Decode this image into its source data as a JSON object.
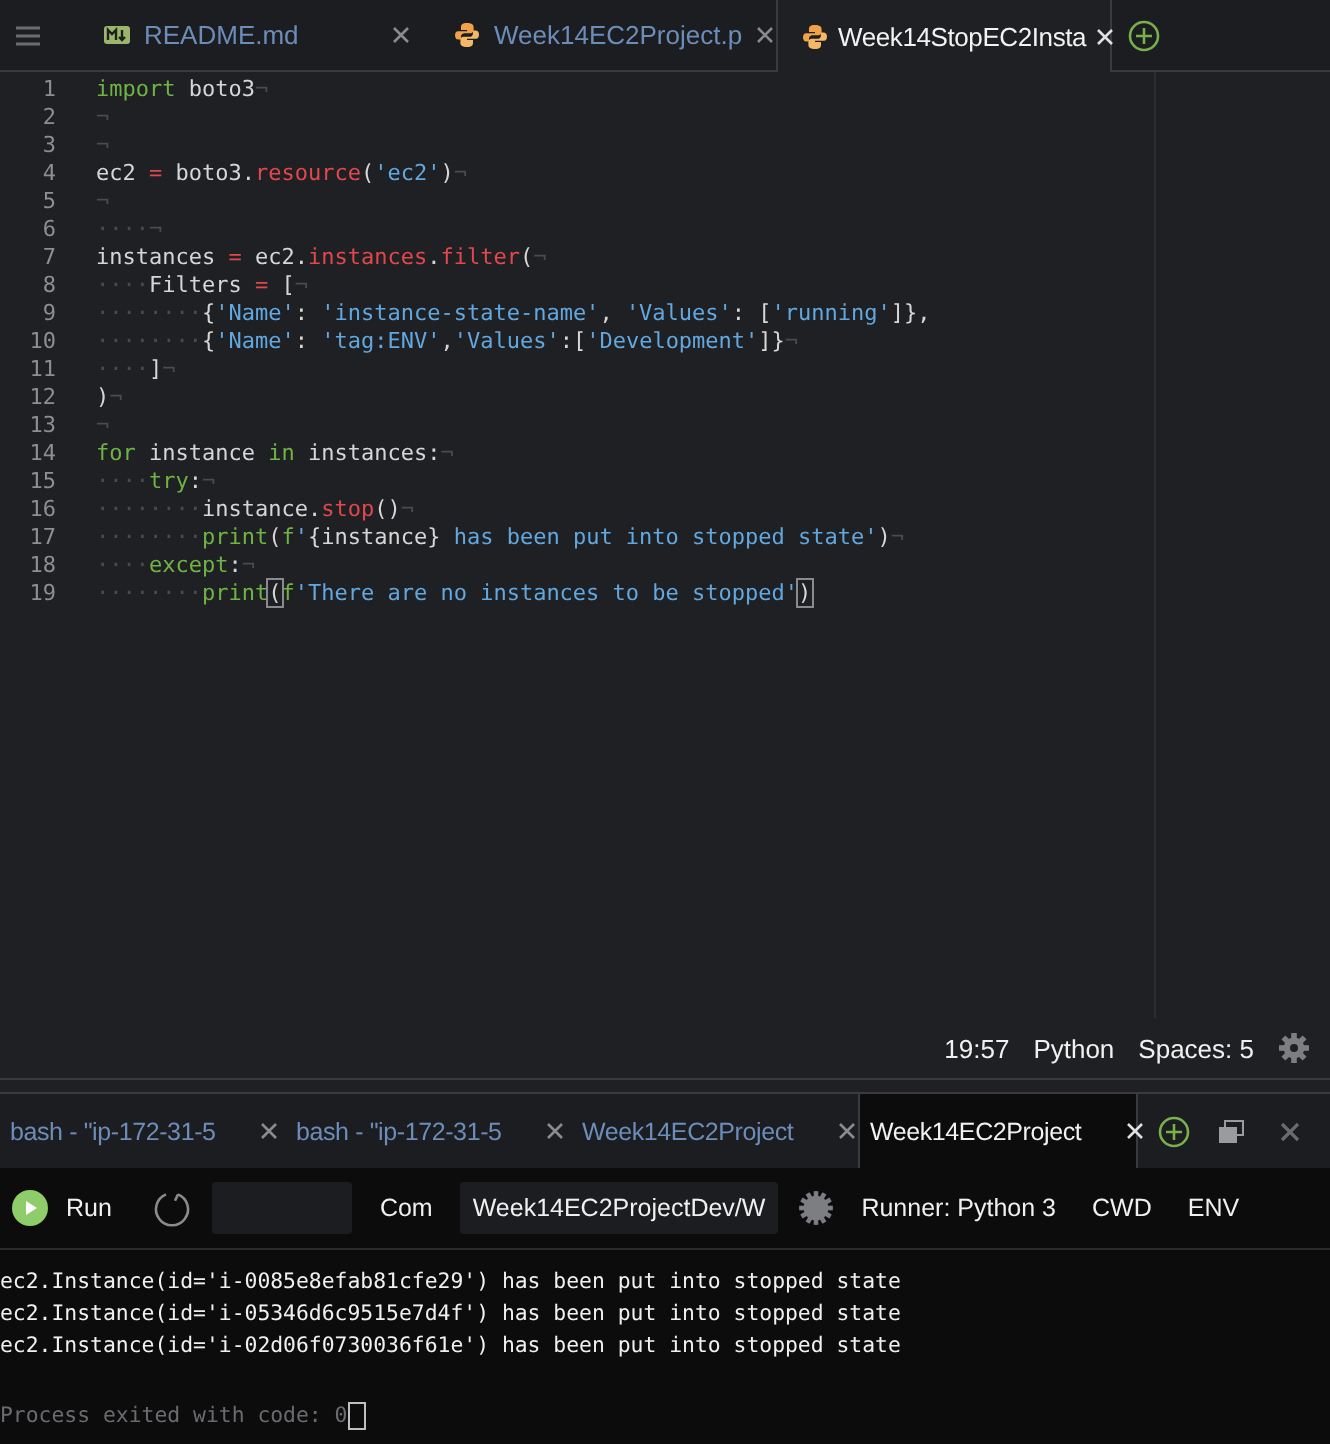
{
  "editor_tabs": [
    {
      "label": "README.md",
      "kind": "markdown",
      "selected": false
    },
    {
      "label": "Week14EC2Project.p",
      "kind": "python",
      "selected": false
    },
    {
      "label": "Week14StopEC2Insta",
      "kind": "python",
      "selected": true
    }
  ],
  "code_lines": [
    {
      "number": "1",
      "tokens": [
        {
          "text": "import",
          "kind": "kw"
        },
        {
          "text": " boto3",
          "kind": "plain"
        },
        {
          "text": "¬",
          "kind": "ws"
        }
      ]
    },
    {
      "number": "2",
      "tokens": [
        {
          "text": "¬",
          "kind": "ws"
        }
      ]
    },
    {
      "number": "3",
      "tokens": [
        {
          "text": "¬",
          "kind": "ws"
        }
      ]
    },
    {
      "number": "4",
      "tokens": [
        {
          "text": "ec2 ",
          "kind": "plain"
        },
        {
          "text": "=",
          "kind": "op"
        },
        {
          "text": " boto3.",
          "kind": "plain"
        },
        {
          "text": "resource",
          "kind": "op"
        },
        {
          "text": "(",
          "kind": "plain"
        },
        {
          "text": "'ec2'",
          "kind": "str"
        },
        {
          "text": ")",
          "kind": "plain"
        },
        {
          "text": "¬",
          "kind": "ws"
        }
      ]
    },
    {
      "number": "5",
      "tokens": [
        {
          "text": "¬",
          "kind": "ws"
        }
      ]
    },
    {
      "number": "6",
      "tokens": [
        {
          "text": "····¬",
          "kind": "ws"
        }
      ]
    },
    {
      "number": "7",
      "tokens": [
        {
          "text": "instances ",
          "kind": "plain"
        },
        {
          "text": "=",
          "kind": "op"
        },
        {
          "text": " ec2.",
          "kind": "plain"
        },
        {
          "text": "instances",
          "kind": "op"
        },
        {
          "text": ".",
          "kind": "plain"
        },
        {
          "text": "filter",
          "kind": "op"
        },
        {
          "text": "(",
          "kind": "plain"
        },
        {
          "text": "¬",
          "kind": "ws"
        }
      ]
    },
    {
      "number": "8",
      "tokens": [
        {
          "text": "····",
          "kind": "ws"
        },
        {
          "text": "Filters ",
          "kind": "plain"
        },
        {
          "text": "=",
          "kind": "op"
        },
        {
          "text": " [",
          "kind": "plain"
        },
        {
          "text": "¬",
          "kind": "ws"
        }
      ]
    },
    {
      "number": "9",
      "tokens": [
        {
          "text": "········",
          "kind": "ws"
        },
        {
          "text": "{",
          "kind": "plain"
        },
        {
          "text": "'Name'",
          "kind": "str"
        },
        {
          "text": ": ",
          "kind": "plain"
        },
        {
          "text": "'instance-state-name'",
          "kind": "str"
        },
        {
          "text": ", ",
          "kind": "plain"
        },
        {
          "text": "'Values'",
          "kind": "str"
        },
        {
          "text": ": [",
          "kind": "plain"
        },
        {
          "text": "'running'",
          "kind": "str"
        },
        {
          "text": "]},",
          "kind": "plain"
        }
      ]
    },
    {
      "number": "10",
      "tokens": [
        {
          "text": "········",
          "kind": "ws"
        },
        {
          "text": "{",
          "kind": "plain"
        },
        {
          "text": "'Name'",
          "kind": "str"
        },
        {
          "text": ": ",
          "kind": "plain"
        },
        {
          "text": "'tag:ENV'",
          "kind": "str"
        },
        {
          "text": ",",
          "kind": "plain"
        },
        {
          "text": "'Values'",
          "kind": "str"
        },
        {
          "text": ":[",
          "kind": "plain"
        },
        {
          "text": "'Development'",
          "kind": "str"
        },
        {
          "text": "]}",
          "kind": "plain"
        },
        {
          "text": "¬",
          "kind": "ws"
        }
      ]
    },
    {
      "number": "11",
      "tokens": [
        {
          "text": "····",
          "kind": "ws"
        },
        {
          "text": "]",
          "kind": "plain"
        },
        {
          "text": "¬",
          "kind": "ws"
        }
      ]
    },
    {
      "number": "12",
      "tokens": [
        {
          "text": ")",
          "kind": "plain"
        },
        {
          "text": "¬",
          "kind": "ws"
        }
      ]
    },
    {
      "number": "13",
      "tokens": [
        {
          "text": "¬",
          "kind": "ws"
        }
      ]
    },
    {
      "number": "14",
      "tokens": [
        {
          "text": "for",
          "kind": "kw"
        },
        {
          "text": " instance ",
          "kind": "plain"
        },
        {
          "text": "in",
          "kind": "kw"
        },
        {
          "text": " instances:",
          "kind": "plain"
        },
        {
          "text": "¬",
          "kind": "ws"
        }
      ]
    },
    {
      "number": "15",
      "tokens": [
        {
          "text": "····",
          "kind": "ws"
        },
        {
          "text": "try",
          "kind": "kw"
        },
        {
          "text": ":",
          "kind": "plain"
        },
        {
          "text": "¬",
          "kind": "ws"
        }
      ]
    },
    {
      "number": "16",
      "tokens": [
        {
          "text": "········",
          "kind": "ws"
        },
        {
          "text": "instance.",
          "kind": "plain"
        },
        {
          "text": "stop",
          "kind": "op"
        },
        {
          "text": "()",
          "kind": "plain"
        },
        {
          "text": "¬",
          "kind": "ws"
        }
      ]
    },
    {
      "number": "17",
      "tokens": [
        {
          "text": "········",
          "kind": "ws"
        },
        {
          "text": "print",
          "kind": "kw"
        },
        {
          "text": "(",
          "kind": "plain"
        },
        {
          "text": "f",
          "kind": "kw"
        },
        {
          "text": "'",
          "kind": "str"
        },
        {
          "text": "{instance}",
          "kind": "plain"
        },
        {
          "text": " has been put into stopped state'",
          "kind": "str"
        },
        {
          "text": ")",
          "kind": "plain"
        },
        {
          "text": "¬",
          "kind": "ws"
        }
      ]
    },
    {
      "number": "18",
      "tokens": [
        {
          "text": "····",
          "kind": "ws"
        },
        {
          "text": "except",
          "kind": "kw"
        },
        {
          "text": ":",
          "kind": "plain"
        },
        {
          "text": "¬",
          "kind": "ws"
        }
      ]
    },
    {
      "number": "19",
      "tokens": [
        {
          "text": "········",
          "kind": "ws"
        },
        {
          "text": "print",
          "kind": "kw"
        },
        {
          "text": "(",
          "kind": "match"
        },
        {
          "text": "f",
          "kind": "kw"
        },
        {
          "text": "'There are no instances to be stopped'",
          "kind": "str"
        },
        {
          "text": ")",
          "kind": "match"
        }
      ]
    }
  ],
  "status_bar": {
    "cursor": "19:57",
    "language": "Python",
    "indentation": "Spaces: 5"
  },
  "terminal_tabs": [
    {
      "label": "bash - \"ip-172-31-5",
      "selected": false
    },
    {
      "label": "bash - \"ip-172-31-5",
      "selected": false
    },
    {
      "label": "Week14EC2Project",
      "selected": false
    },
    {
      "label": "Week14EC2Project",
      "selected": true
    }
  ],
  "run_toolbar": {
    "run": "Run",
    "command_label": "Com",
    "command": "Week14EC2ProjectDev/W",
    "runner": "Runner: Python 3",
    "cwd": "CWD",
    "env": "ENV"
  },
  "output": {
    "lines": [
      "ec2.Instance(id='i-0085e8efab81cfe29') has been put into stopped state",
      "ec2.Instance(id='i-05346d6c9515e7d4f') has been put into stopped state",
      "ec2.Instance(id='i-02d06f0730036f61e') has been put into stopped state"
    ],
    "exit_message": "Process exited with code: 0"
  }
}
